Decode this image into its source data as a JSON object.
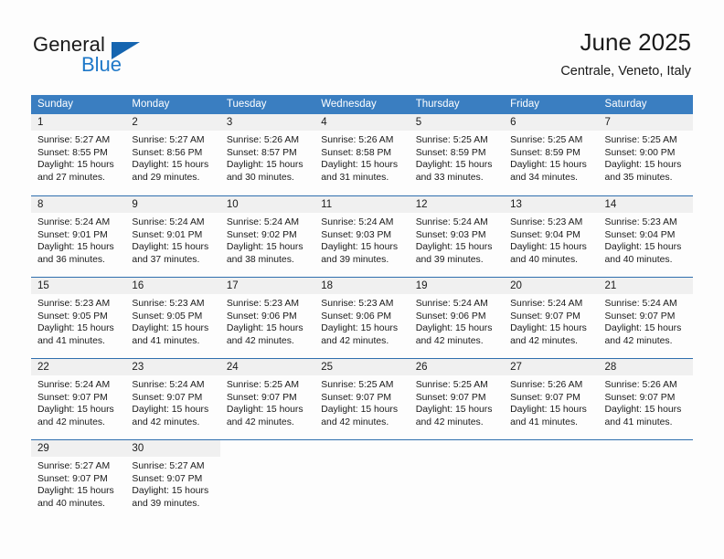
{
  "brand": {
    "word1": "General",
    "word2": "Blue",
    "triangle_color": "#1565b0",
    "blue_text_color": "#1e78c8"
  },
  "header": {
    "title": "June 2025",
    "subtitle": "Centrale, Veneto, Italy"
  },
  "theme": {
    "header_row_bg": "#3a7ec1",
    "week_divider": "#2f6fae",
    "day_band_bg": "#f0f0f0",
    "page_bg": "#fdfdfd",
    "text": "#1a1a1a"
  },
  "weekdays": [
    "Sunday",
    "Monday",
    "Tuesday",
    "Wednesday",
    "Thursday",
    "Friday",
    "Saturday"
  ],
  "weeks": [
    [
      {
        "day": "1",
        "sunrise": "Sunrise: 5:27 AM",
        "sunset": "Sunset: 8:55 PM",
        "daylight_line1": "Daylight: 15 hours",
        "daylight_line2": "and 27 minutes."
      },
      {
        "day": "2",
        "sunrise": "Sunrise: 5:27 AM",
        "sunset": "Sunset: 8:56 PM",
        "daylight_line1": "Daylight: 15 hours",
        "daylight_line2": "and 29 minutes."
      },
      {
        "day": "3",
        "sunrise": "Sunrise: 5:26 AM",
        "sunset": "Sunset: 8:57 PM",
        "daylight_line1": "Daylight: 15 hours",
        "daylight_line2": "and 30 minutes."
      },
      {
        "day": "4",
        "sunrise": "Sunrise: 5:26 AM",
        "sunset": "Sunset: 8:58 PM",
        "daylight_line1": "Daylight: 15 hours",
        "daylight_line2": "and 31 minutes."
      },
      {
        "day": "5",
        "sunrise": "Sunrise: 5:25 AM",
        "sunset": "Sunset: 8:59 PM",
        "daylight_line1": "Daylight: 15 hours",
        "daylight_line2": "and 33 minutes."
      },
      {
        "day": "6",
        "sunrise": "Sunrise: 5:25 AM",
        "sunset": "Sunset: 8:59 PM",
        "daylight_line1": "Daylight: 15 hours",
        "daylight_line2": "and 34 minutes."
      },
      {
        "day": "7",
        "sunrise": "Sunrise: 5:25 AM",
        "sunset": "Sunset: 9:00 PM",
        "daylight_line1": "Daylight: 15 hours",
        "daylight_line2": "and 35 minutes."
      }
    ],
    [
      {
        "day": "8",
        "sunrise": "Sunrise: 5:24 AM",
        "sunset": "Sunset: 9:01 PM",
        "daylight_line1": "Daylight: 15 hours",
        "daylight_line2": "and 36 minutes."
      },
      {
        "day": "9",
        "sunrise": "Sunrise: 5:24 AM",
        "sunset": "Sunset: 9:01 PM",
        "daylight_line1": "Daylight: 15 hours",
        "daylight_line2": "and 37 minutes."
      },
      {
        "day": "10",
        "sunrise": "Sunrise: 5:24 AM",
        "sunset": "Sunset: 9:02 PM",
        "daylight_line1": "Daylight: 15 hours",
        "daylight_line2": "and 38 minutes."
      },
      {
        "day": "11",
        "sunrise": "Sunrise: 5:24 AM",
        "sunset": "Sunset: 9:03 PM",
        "daylight_line1": "Daylight: 15 hours",
        "daylight_line2": "and 39 minutes."
      },
      {
        "day": "12",
        "sunrise": "Sunrise: 5:24 AM",
        "sunset": "Sunset: 9:03 PM",
        "daylight_line1": "Daylight: 15 hours",
        "daylight_line2": "and 39 minutes."
      },
      {
        "day": "13",
        "sunrise": "Sunrise: 5:23 AM",
        "sunset": "Sunset: 9:04 PM",
        "daylight_line1": "Daylight: 15 hours",
        "daylight_line2": "and 40 minutes."
      },
      {
        "day": "14",
        "sunrise": "Sunrise: 5:23 AM",
        "sunset": "Sunset: 9:04 PM",
        "daylight_line1": "Daylight: 15 hours",
        "daylight_line2": "and 40 minutes."
      }
    ],
    [
      {
        "day": "15",
        "sunrise": "Sunrise: 5:23 AM",
        "sunset": "Sunset: 9:05 PM",
        "daylight_line1": "Daylight: 15 hours",
        "daylight_line2": "and 41 minutes."
      },
      {
        "day": "16",
        "sunrise": "Sunrise: 5:23 AM",
        "sunset": "Sunset: 9:05 PM",
        "daylight_line1": "Daylight: 15 hours",
        "daylight_line2": "and 41 minutes."
      },
      {
        "day": "17",
        "sunrise": "Sunrise: 5:23 AM",
        "sunset": "Sunset: 9:06 PM",
        "daylight_line1": "Daylight: 15 hours",
        "daylight_line2": "and 42 minutes."
      },
      {
        "day": "18",
        "sunrise": "Sunrise: 5:23 AM",
        "sunset": "Sunset: 9:06 PM",
        "daylight_line1": "Daylight: 15 hours",
        "daylight_line2": "and 42 minutes."
      },
      {
        "day": "19",
        "sunrise": "Sunrise: 5:24 AM",
        "sunset": "Sunset: 9:06 PM",
        "daylight_line1": "Daylight: 15 hours",
        "daylight_line2": "and 42 minutes."
      },
      {
        "day": "20",
        "sunrise": "Sunrise: 5:24 AM",
        "sunset": "Sunset: 9:07 PM",
        "daylight_line1": "Daylight: 15 hours",
        "daylight_line2": "and 42 minutes."
      },
      {
        "day": "21",
        "sunrise": "Sunrise: 5:24 AM",
        "sunset": "Sunset: 9:07 PM",
        "daylight_line1": "Daylight: 15 hours",
        "daylight_line2": "and 42 minutes."
      }
    ],
    [
      {
        "day": "22",
        "sunrise": "Sunrise: 5:24 AM",
        "sunset": "Sunset: 9:07 PM",
        "daylight_line1": "Daylight: 15 hours",
        "daylight_line2": "and 42 minutes."
      },
      {
        "day": "23",
        "sunrise": "Sunrise: 5:24 AM",
        "sunset": "Sunset: 9:07 PM",
        "daylight_line1": "Daylight: 15 hours",
        "daylight_line2": "and 42 minutes."
      },
      {
        "day": "24",
        "sunrise": "Sunrise: 5:25 AM",
        "sunset": "Sunset: 9:07 PM",
        "daylight_line1": "Daylight: 15 hours",
        "daylight_line2": "and 42 minutes."
      },
      {
        "day": "25",
        "sunrise": "Sunrise: 5:25 AM",
        "sunset": "Sunset: 9:07 PM",
        "daylight_line1": "Daylight: 15 hours",
        "daylight_line2": "and 42 minutes."
      },
      {
        "day": "26",
        "sunrise": "Sunrise: 5:25 AM",
        "sunset": "Sunset: 9:07 PM",
        "daylight_line1": "Daylight: 15 hours",
        "daylight_line2": "and 42 minutes."
      },
      {
        "day": "27",
        "sunrise": "Sunrise: 5:26 AM",
        "sunset": "Sunset: 9:07 PM",
        "daylight_line1": "Daylight: 15 hours",
        "daylight_line2": "and 41 minutes."
      },
      {
        "day": "28",
        "sunrise": "Sunrise: 5:26 AM",
        "sunset": "Sunset: 9:07 PM",
        "daylight_line1": "Daylight: 15 hours",
        "daylight_line2": "and 41 minutes."
      }
    ],
    [
      {
        "day": "29",
        "sunrise": "Sunrise: 5:27 AM",
        "sunset": "Sunset: 9:07 PM",
        "daylight_line1": "Daylight: 15 hours",
        "daylight_line2": "and 40 minutes."
      },
      {
        "day": "30",
        "sunrise": "Sunrise: 5:27 AM",
        "sunset": "Sunset: 9:07 PM",
        "daylight_line1": "Daylight: 15 hours",
        "daylight_line2": "and 39 minutes."
      },
      {
        "day": "",
        "sunrise": "",
        "sunset": "",
        "daylight_line1": "",
        "daylight_line2": ""
      },
      {
        "day": "",
        "sunrise": "",
        "sunset": "",
        "daylight_line1": "",
        "daylight_line2": ""
      },
      {
        "day": "",
        "sunrise": "",
        "sunset": "",
        "daylight_line1": "",
        "daylight_line2": ""
      },
      {
        "day": "",
        "sunrise": "",
        "sunset": "",
        "daylight_line1": "",
        "daylight_line2": ""
      },
      {
        "day": "",
        "sunrise": "",
        "sunset": "",
        "daylight_line1": "",
        "daylight_line2": ""
      }
    ]
  ]
}
